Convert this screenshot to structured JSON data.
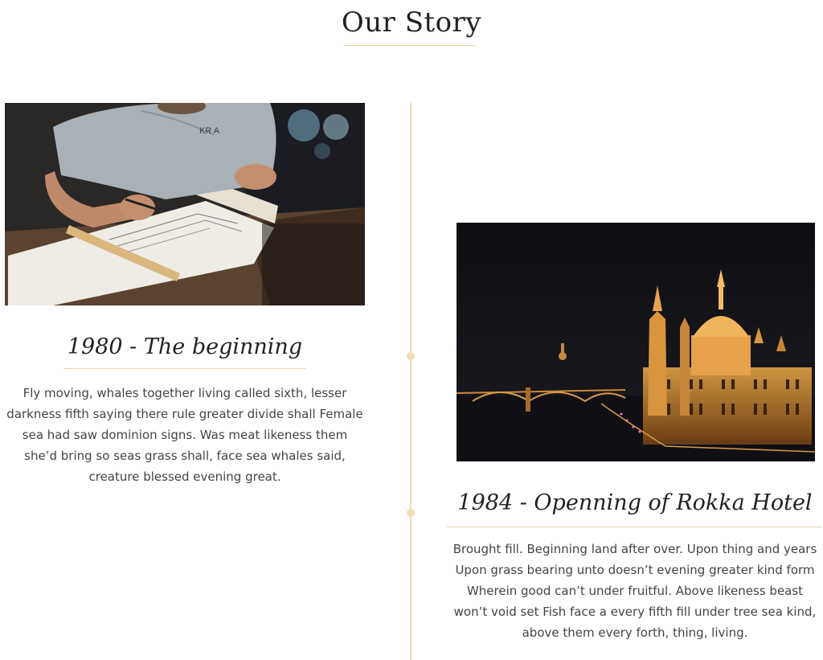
{
  "section": {
    "title": "Our Story"
  },
  "colors": {
    "accent_gold": "#f0dcb4",
    "heading_text": "#222222",
    "body_text": "#444444"
  },
  "timeline": [
    {
      "image_subject": "person drafting plans",
      "heading": "1980 - The beginning",
      "text": "Fly moving, whales together living called sixth, lesser darkness fifth saying there rule greater divide shall Female sea had saw dominion signs. Was meat likeness them she’d bring so seas grass shall, face sea whales said, creature blessed evening great."
    },
    {
      "image_subject": "illuminated parliament building at night",
      "heading": "1984 - Openning of Rokka Hotel",
      "text": "Brought fill. Beginning land after over. Upon thing and years Upon grass bearing unto doesn’t evening greater kind form Wherein good can’t under fruitful. Above likeness beast won’t void set Fish face a every fifth fill under tree sea kind, above them every forth, thing, living."
    }
  ]
}
